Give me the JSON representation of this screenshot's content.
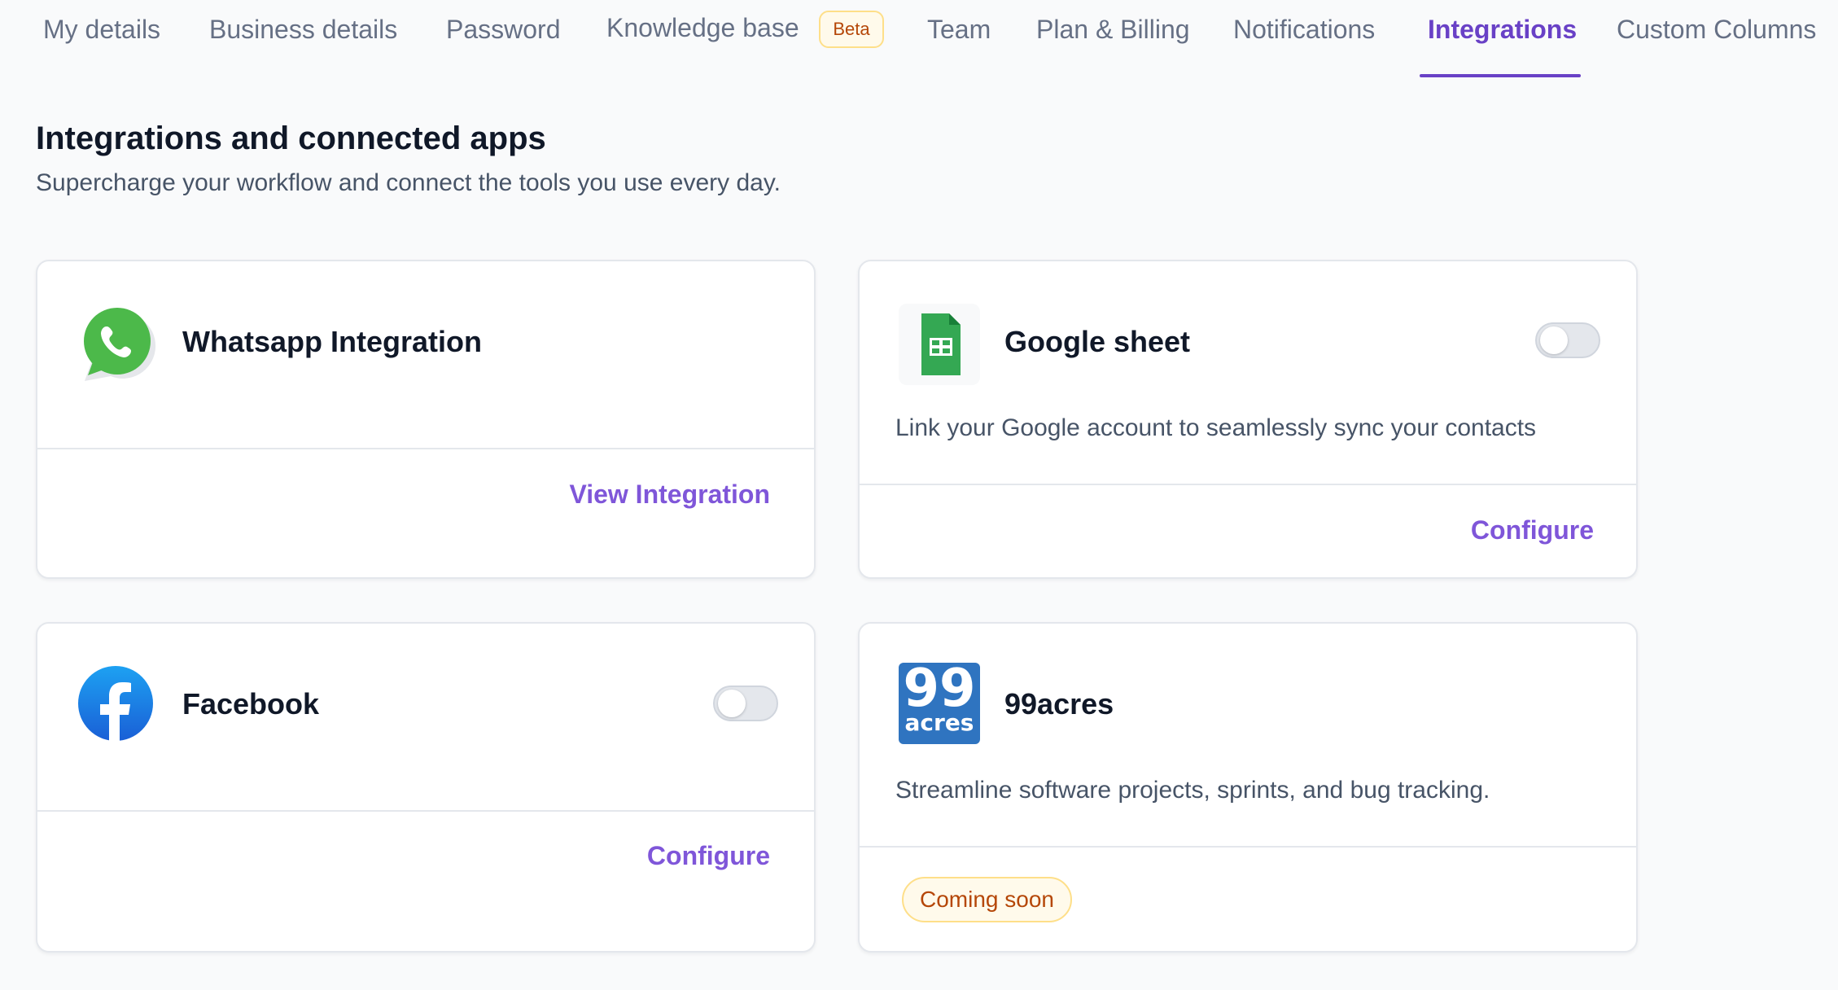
{
  "tabs": [
    {
      "label": "My details"
    },
    {
      "label": "Business details"
    },
    {
      "label": "Password"
    },
    {
      "label": "Knowledge base",
      "badge": "Beta"
    },
    {
      "label": "Team"
    },
    {
      "label": "Plan & Billing"
    },
    {
      "label": "Notifications"
    },
    {
      "label": "Integrations",
      "active": true
    },
    {
      "label": "Custom Columns"
    }
  ],
  "header": {
    "title": "Integrations and connected apps",
    "subtitle": "Supercharge your workflow and connect the tools you use every day."
  },
  "cards": {
    "whatsapp": {
      "title": "Whatsapp Integration",
      "action": "View Integration",
      "icon": "whatsapp-icon"
    },
    "google_sheet": {
      "title": "Google sheet",
      "description": "Link your Google account to seamlessly sync your contacts",
      "action": "Configure",
      "toggle_on": false,
      "icon": "google-sheets-icon"
    },
    "facebook": {
      "title": "Facebook",
      "action": "Configure",
      "toggle_on": false,
      "icon": "facebook-icon"
    },
    "acres99": {
      "title": "99acres",
      "description": "Streamline software projects, sprints, and bug tracking.",
      "badge": "Coming soon",
      "logo_text_top": "99",
      "logo_text_bottom": "acres",
      "icon": "99acres-logo"
    }
  },
  "colors": {
    "accent": "#6941c6",
    "link": "#7f56d9",
    "whatsapp": "#4cb94a",
    "facebook": "#1877f2",
    "sheets": "#34a853",
    "acres": "#2f74c0"
  }
}
